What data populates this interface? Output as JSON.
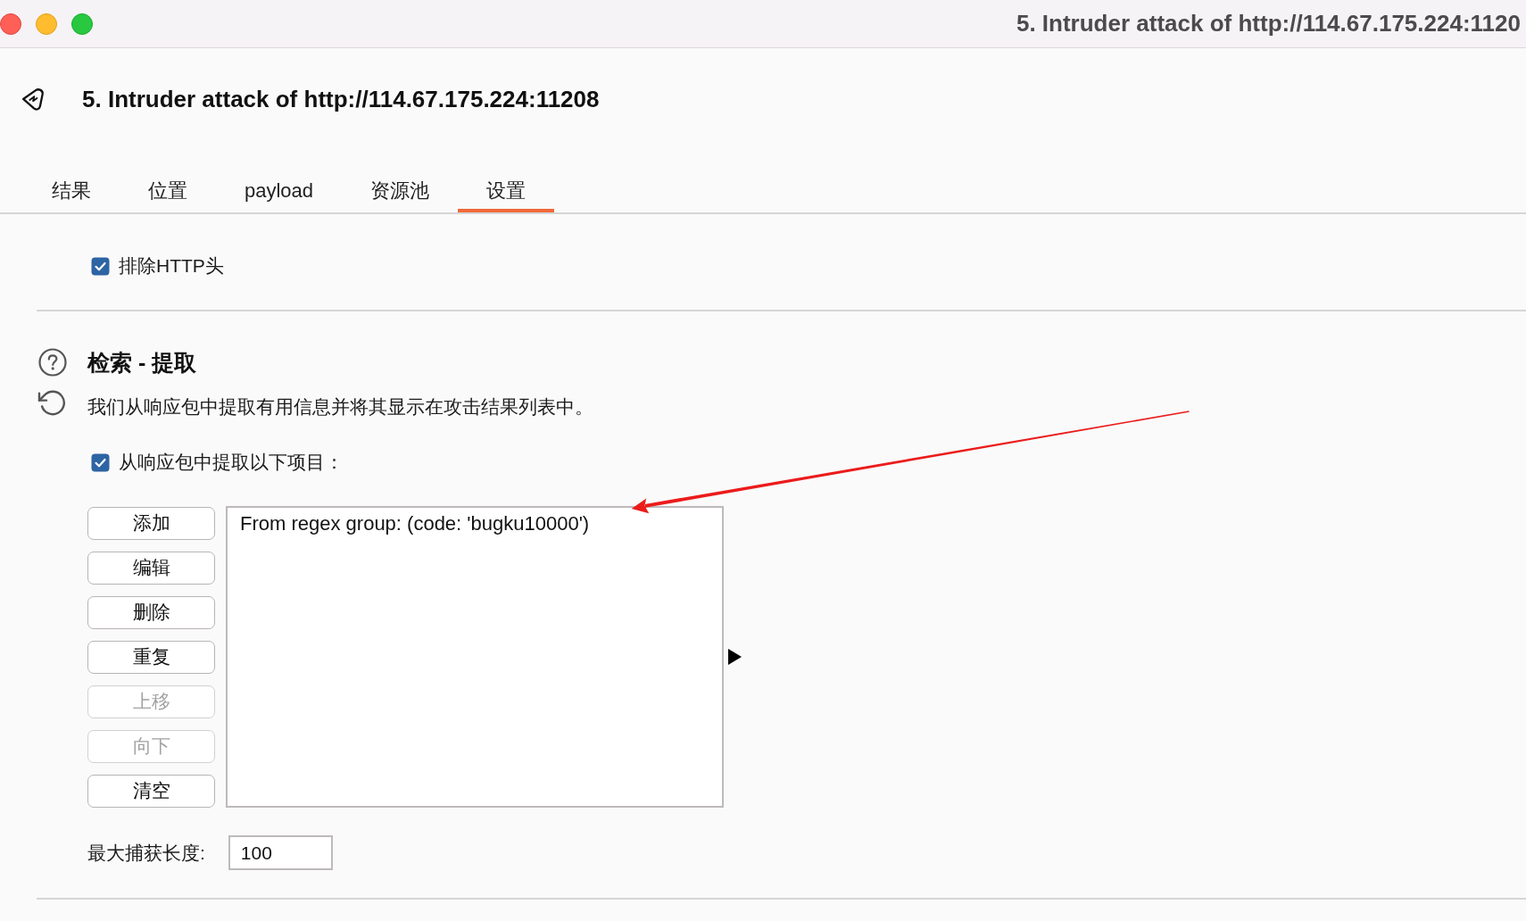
{
  "window": {
    "title": "5. Intruder attack of http://114.67.175.224:1120"
  },
  "header": {
    "title": "5. Intruder attack of http://114.67.175.224:11208"
  },
  "tabs": [
    {
      "label": "结果",
      "selected": false
    },
    {
      "label": "位置",
      "selected": false
    },
    {
      "label": "payload",
      "selected": false
    },
    {
      "label": "资源池",
      "selected": false
    },
    {
      "label": "设置",
      "selected": true
    }
  ],
  "exclude_http_headers": {
    "label": "排除HTTP头",
    "checked": true
  },
  "grep_extract": {
    "title": "检索 - 提取",
    "description": "我们从响应包中提取有用信息并将其显示在攻击结果列表中。",
    "extract_option": {
      "label": "从响应包中提取以下项目：",
      "checked": true
    },
    "buttons": [
      {
        "label": "添加",
        "disabled": false
      },
      {
        "label": "编辑",
        "disabled": false
      },
      {
        "label": "删除",
        "disabled": false
      },
      {
        "label": "重复",
        "disabled": false
      },
      {
        "label": "上移",
        "disabled": true
      },
      {
        "label": "向下",
        "disabled": true
      },
      {
        "label": "清空",
        "disabled": false
      }
    ],
    "items": [
      {
        "text": "From regex group: (code: 'bugku10000')",
        "selected": false
      }
    ],
    "max_capture_length": {
      "label": "最大捕获长度:",
      "value": "100"
    }
  },
  "annotations": [
    {
      "kind": "arrow"
    }
  ]
}
